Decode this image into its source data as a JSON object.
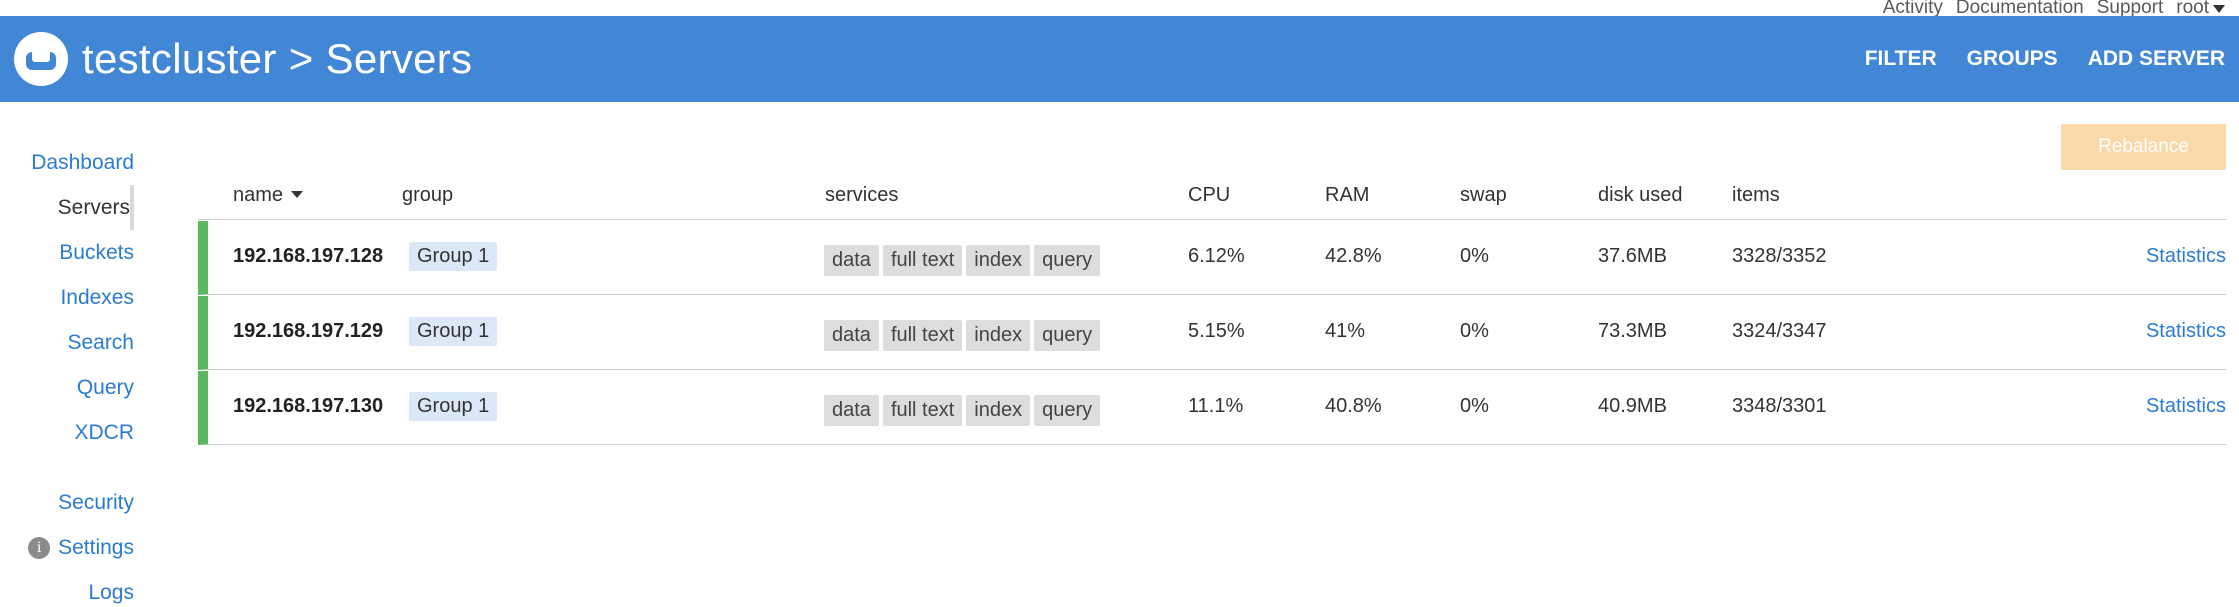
{
  "utility": {
    "activity": "Activity",
    "documentation": "Documentation",
    "support": "Support",
    "user": "root"
  },
  "header": {
    "cluster": "testcluster",
    "separator": ">",
    "page": "Servers",
    "actions": {
      "filter": "FILTER",
      "groups": "GROUPS",
      "add_server": "ADD SERVER"
    }
  },
  "sidebar": {
    "items": [
      {
        "label": "Dashboard"
      },
      {
        "label": "Servers"
      },
      {
        "label": "Buckets"
      },
      {
        "label": "Indexes"
      },
      {
        "label": "Search"
      },
      {
        "label": "Query"
      },
      {
        "label": "XDCR"
      },
      {
        "label": "Security"
      },
      {
        "label": "Settings"
      },
      {
        "label": "Logs"
      }
    ],
    "active": "Servers",
    "info_icon_glyph": "i"
  },
  "rebalance_label": "Rebalance",
  "table": {
    "headers": {
      "name": "name",
      "group": "group",
      "services": "services",
      "cpu": "CPU",
      "ram": "RAM",
      "swap": "swap",
      "disk": "disk used",
      "items": "items"
    },
    "rows": [
      {
        "host": "192.168.197.128",
        "group": "Group 1",
        "services": [
          "data",
          "full text",
          "index",
          "query"
        ],
        "cpu": "6.12%",
        "ram": "42.8%",
        "swap": "0%",
        "disk": "37.6MB",
        "items": "3328/3352",
        "link": "Statistics"
      },
      {
        "host": "192.168.197.129",
        "group": "Group 1",
        "services": [
          "data",
          "full text",
          "index",
          "query"
        ],
        "cpu": "5.15%",
        "ram": "41%",
        "swap": "0%",
        "disk": "73.3MB",
        "items": "3324/3347",
        "link": "Statistics"
      },
      {
        "host": "192.168.197.130",
        "group": "Group 1",
        "services": [
          "data",
          "full text",
          "index",
          "query"
        ],
        "cpu": "11.1%",
        "ram": "40.8%",
        "swap": "0%",
        "disk": "40.9MB",
        "items": "3348/3301",
        "link": "Statistics"
      }
    ]
  },
  "colors": {
    "header_bg": "#4287d6",
    "link": "#2a7bd4",
    "status_ok": "#5cb85c",
    "rebalance_disabled": "#fbd8a9"
  }
}
